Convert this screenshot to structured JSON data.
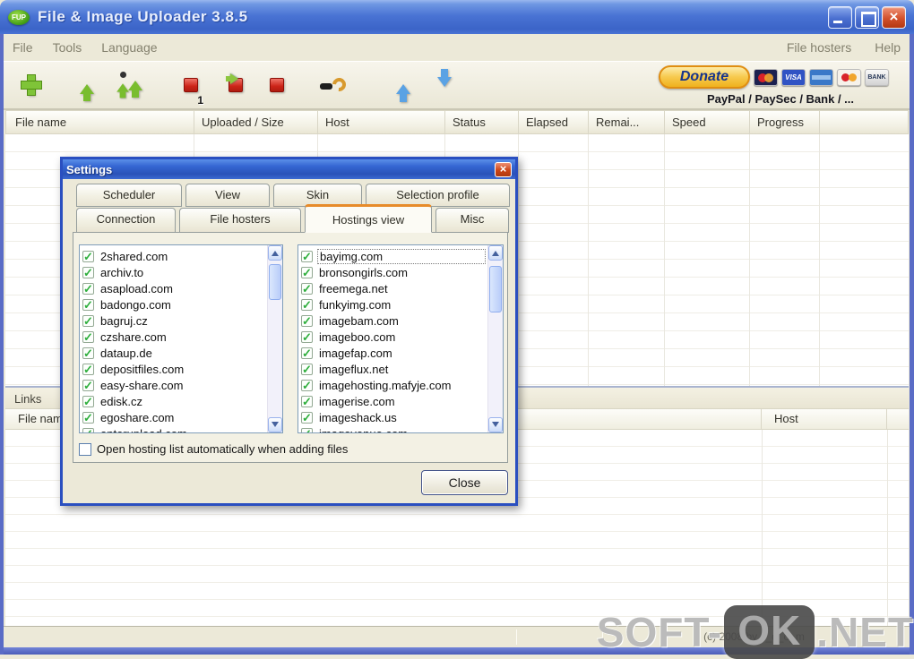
{
  "window": {
    "title": "File & Image Uploader 3.8.5",
    "icon_label": "FUP",
    "close_glyph": "×"
  },
  "menubar": {
    "left_items": [
      "File",
      "Tools",
      "Language"
    ],
    "right_items": [
      "File hosters",
      "Help"
    ]
  },
  "toolbar": {
    "buttons": [
      "add-files",
      "start-upload",
      "start-all-uploads",
      "stop-upload",
      "skip-upload",
      "stop-all-uploads",
      "settings-wrench",
      "move-up",
      "move-down"
    ],
    "stop_badge": "1",
    "donate_label": "Donate",
    "payment_methods": "PayPal / PaySec / Bank / ...",
    "cards": [
      "MasterCard",
      "VISA",
      "American Express",
      "Maestro",
      "Bank"
    ],
    "card_visa_label": "VISA",
    "card_bank_label": "BANK"
  },
  "upload_table": {
    "columns": [
      "File name",
      "Uploaded / Size",
      "Host",
      "Status",
      "Elapsed",
      "Remai...",
      "Speed",
      "Progress"
    ]
  },
  "links_panel": {
    "label": "Links",
    "columns": [
      "File name",
      "Host"
    ]
  },
  "status_bar": {
    "copyright": "(c) 2008 by z_o_o_m"
  },
  "watermark": {
    "left": "SOFT-",
    "badge": "OK",
    "right": ".NET"
  },
  "icons": {
    "check": "✓",
    "close": "×"
  },
  "settings_dialog": {
    "title": "Settings",
    "tabs_row1": [
      "Scheduler",
      "View",
      "Skin",
      "Selection profile"
    ],
    "tabs_row2": [
      "Connection",
      "File hosters",
      "Hostings view",
      "Misc"
    ],
    "active_tab": "Hostings view",
    "file_hosts": [
      "2shared.com",
      "archiv.to",
      "asapload.com",
      "badongo.com",
      "bagruj.cz",
      "czshare.com",
      "dataup.de",
      "depositfiles.com",
      "easy-share.com",
      "edisk.cz",
      "egoshare.com",
      "enterupload.com"
    ],
    "image_hosts": [
      "bayimg.com",
      "bronsongirls.com",
      "freemega.net",
      "funkyimg.com",
      "imagebam.com",
      "imageboo.com",
      "imagefap.com",
      "imageflux.net",
      "imagehosting.mafyje.com",
      "imagerise.com",
      "imageshack.us",
      "imagevenue.com"
    ],
    "checkbox_label": "Open hosting list automatically when adding files",
    "close_button": "Close"
  }
}
